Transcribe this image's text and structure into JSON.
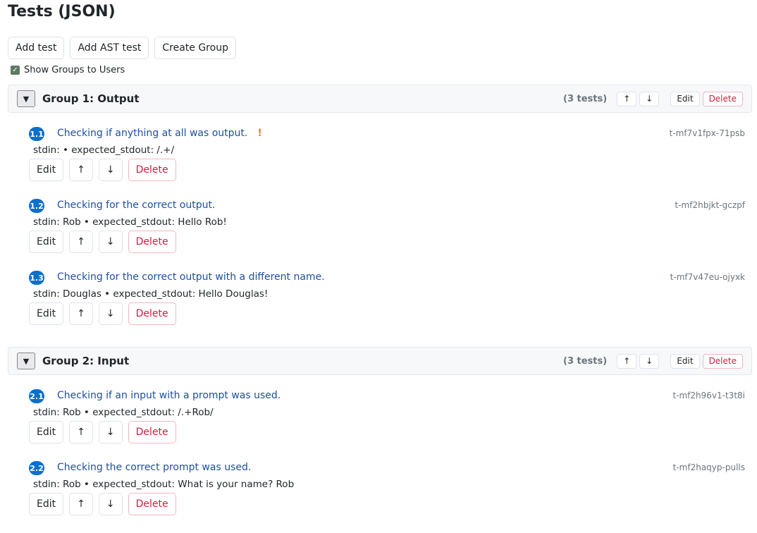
{
  "page": {
    "title": "Tests (JSON)"
  },
  "toolbar": {
    "add_test": "Add test",
    "add_ast_test": "Add AST test",
    "create_group": "Create Group"
  },
  "show_groups": {
    "label": "Show Groups to Users",
    "checked": true
  },
  "labels": {
    "edit": "Edit",
    "delete": "Delete",
    "up": "↑",
    "down": "↓",
    "toggle": "▼",
    "warn": "!"
  },
  "colors": {
    "badge": "#0b6fcc",
    "delete": "#c8233f",
    "checkbox": "#5f7a64",
    "warning": "#f07a2a"
  },
  "groups": [
    {
      "title": "Group 1: Output",
      "count": "(3 tests)",
      "tests": [
        {
          "num": "1.1",
          "title": "Checking if anything at all was output.",
          "warning": true,
          "id": "t-mf7v1fpx-71psb",
          "detail": "stdin: • expected_stdout: /.+/"
        },
        {
          "num": "1.2",
          "title": "Checking for the correct output.",
          "warning": false,
          "id": "t-mf2hbjkt-gczpf",
          "detail": "stdin: Rob • expected_stdout: Hello Rob!"
        },
        {
          "num": "1.3",
          "title": "Checking for the correct output with a different name.",
          "warning": false,
          "id": "t-mf7v47eu-ojyxk",
          "detail": "stdin: Douglas • expected_stdout: Hello Douglas!"
        }
      ]
    },
    {
      "title": "Group 2: Input",
      "count": "(3 tests)",
      "tests": [
        {
          "num": "2.1",
          "title": "Checking if an input with a prompt was used.",
          "warning": false,
          "id": "t-mf2h96v1-t3t8i",
          "detail": "stdin: Rob • expected_stdout: /.+Rob/"
        },
        {
          "num": "2.2",
          "title": "Checking the correct prompt was used.",
          "warning": false,
          "id": "t-mf2haqyp-pulls",
          "detail": "stdin: Rob • expected_stdout: What is your name? Rob"
        }
      ]
    }
  ]
}
